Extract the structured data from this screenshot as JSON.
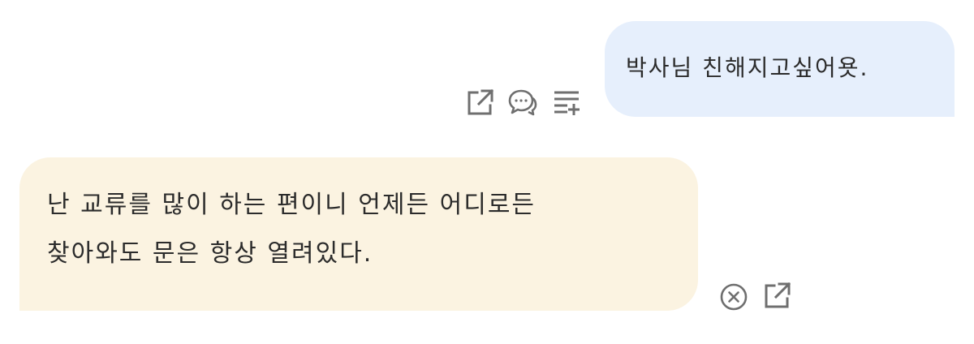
{
  "conversation": {
    "user_message": {
      "text": "박사님 친해지고싶어욧."
    },
    "user_message_actions": [
      {
        "icon": "share-external-icon"
      },
      {
        "icon": "chat-bubbles-icon"
      },
      {
        "icon": "add-to-playlist-icon"
      }
    ],
    "bot_message": {
      "lines": [
        "난 교류를 많이 하는 편이니 언제든 어디로든",
        "찾아와도 문은 항상 열려있다."
      ]
    },
    "bot_message_actions": [
      {
        "icon": "close-circle-icon"
      },
      {
        "icon": "share-external-icon"
      }
    ]
  },
  "colors": {
    "user_bubble": "#e6effc",
    "bot_bubble": "#fbf3e1",
    "text": "#2b2b2b",
    "icon": "#6f6f6f"
  }
}
